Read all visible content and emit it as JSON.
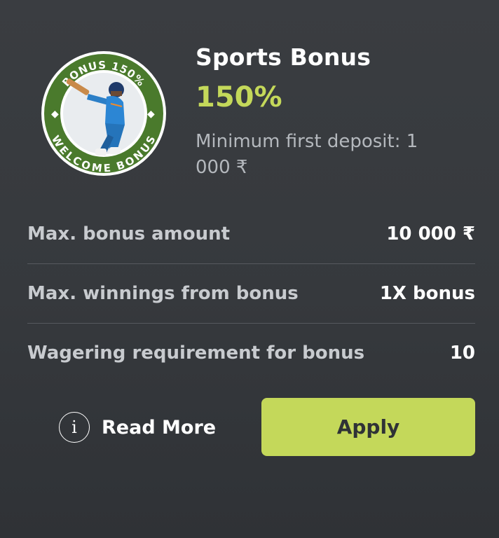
{
  "bonus": {
    "badge_top_text": "BONUS 150%",
    "badge_bottom_text": "WELCOME BONUS",
    "title": "Sports Bonus",
    "percent": "150%",
    "min_deposit": "Minimum first deposit: 1 000 ₹"
  },
  "details": [
    {
      "label": "Max. bonus amount",
      "value": "10 000 ₹"
    },
    {
      "label": "Max. winnings from bonus",
      "value": "1X bonus"
    },
    {
      "label": "Wagering requirement for bonus",
      "value": "10"
    }
  ],
  "actions": {
    "read_more_icon": "info-icon",
    "read_more_icon_glyph": "i",
    "read_more_label": "Read More",
    "apply_label": "Apply"
  },
  "colors": {
    "background": "#36393d",
    "accent": "#c4d85a",
    "badge_green": "#4a7a2c",
    "text_primary": "#ffffff",
    "text_secondary": "#b4b8bd"
  }
}
